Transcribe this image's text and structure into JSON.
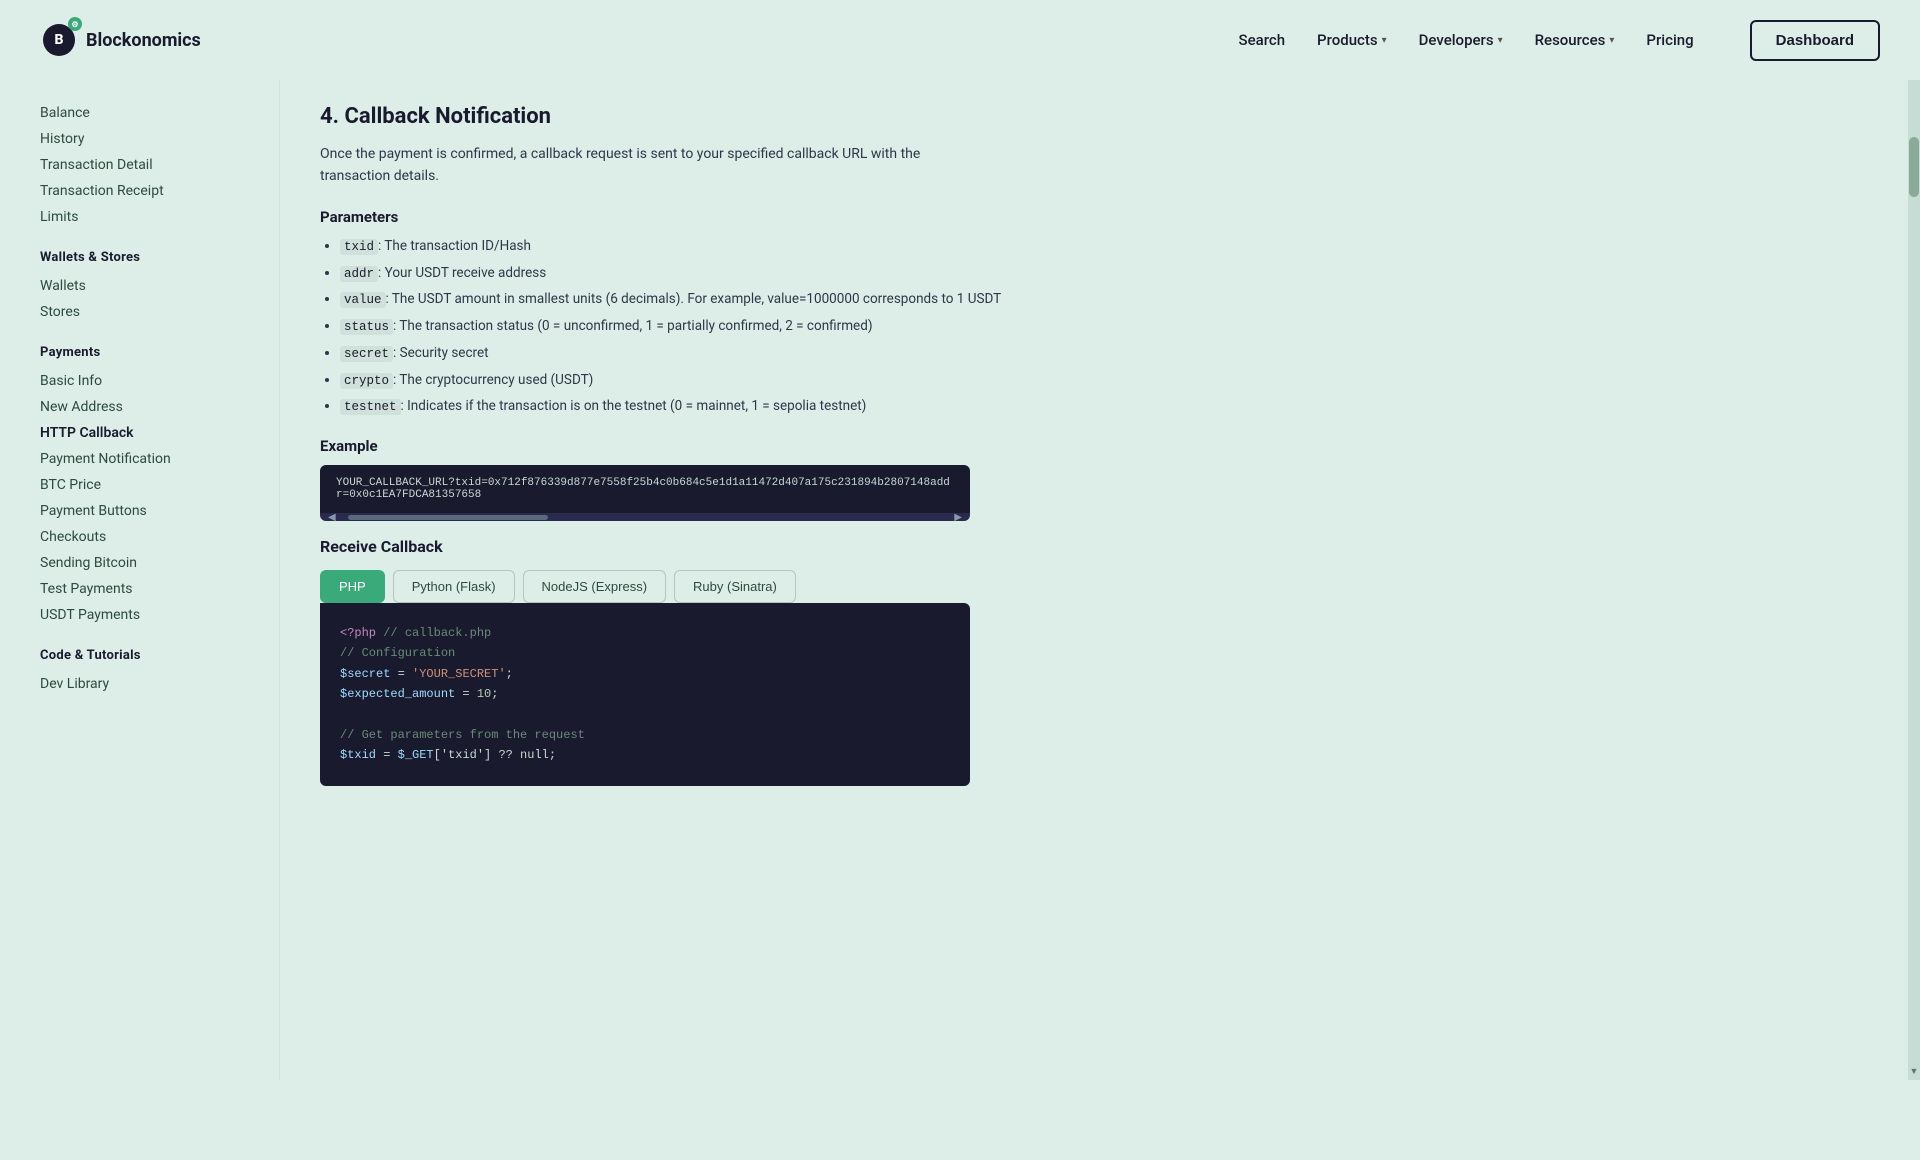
{
  "brand": {
    "name": "Blockonomics",
    "logo_letter": "B"
  },
  "nav": {
    "search": "Search",
    "products": "Products",
    "developers": "Developers",
    "resources": "Resources",
    "pricing": "Pricing",
    "dashboard": "Dashboard"
  },
  "sidebar": {
    "section_payments_above": {
      "items": [
        {
          "label": "Balance",
          "id": "balance"
        },
        {
          "label": "History",
          "id": "history"
        },
        {
          "label": "Transaction Detail",
          "id": "transaction-detail"
        },
        {
          "label": "Transaction Receipt",
          "id": "transaction-receipt"
        },
        {
          "label": "Limits",
          "id": "limits"
        }
      ]
    },
    "wallets_stores": {
      "title": "Wallets & Stores",
      "items": [
        {
          "label": "Wallets",
          "id": "wallets"
        },
        {
          "label": "Stores",
          "id": "stores"
        }
      ]
    },
    "payments": {
      "title": "Payments",
      "items": [
        {
          "label": "Basic Info",
          "id": "basic-info"
        },
        {
          "label": "New Address",
          "id": "new-address"
        },
        {
          "label": "HTTP Callback",
          "id": "http-callback"
        },
        {
          "label": "Payment Notification",
          "id": "payment-notification"
        },
        {
          "label": "BTC Price",
          "id": "btc-price"
        },
        {
          "label": "Payment Buttons",
          "id": "payment-buttons"
        },
        {
          "label": "Checkouts",
          "id": "checkouts"
        },
        {
          "label": "Sending Bitcoin",
          "id": "sending-bitcoin"
        },
        {
          "label": "Test Payments",
          "id": "test-payments"
        },
        {
          "label": "USDT Payments",
          "id": "usdt-payments"
        }
      ]
    },
    "code_tutorials": {
      "title": "Code & Tutorials",
      "items": [
        {
          "label": "Dev Library",
          "id": "dev-library"
        }
      ]
    }
  },
  "main": {
    "section_number": "4.",
    "section_title": "Callback Notification",
    "intro": "Once the payment is confirmed, a callback request is sent to your specified callback URL with the transaction details.",
    "parameters_heading": "Parameters",
    "params": [
      {
        "code": "txid",
        "desc": "The transaction ID/Hash"
      },
      {
        "code": "addr",
        "desc": "Your USDT receive address"
      },
      {
        "code": "value",
        "desc": "The USDT amount in smallest units (6 decimals). For example, value=1000000 corresponds to 1 USDT"
      },
      {
        "code": "status",
        "desc": "The transaction status (0 = unconfirmed, 1 = partially confirmed, 2 = confirmed)"
      },
      {
        "code": "secret",
        "desc": "Security secret"
      },
      {
        "code": "crypto",
        "desc": "The cryptocurrency used (USDT)"
      },
      {
        "code": "testnet",
        "desc": "Indicates if the transaction is on the testnet (0 = mainnet, 1 = sepolia testnet)"
      }
    ],
    "example_heading": "Example",
    "example_url": "YOUR_CALLBACK_URL?txid=0x712f876339d877e7558f25b4c0b684c5e1d1a11472d407a175c231894b2807148addr=0x0c1EA7FDCA81357658",
    "receive_callback_heading": "Receive Callback",
    "lang_tabs": [
      {
        "label": "PHP",
        "id": "php",
        "active": true
      },
      {
        "label": "Python (Flask)",
        "id": "python",
        "active": false
      },
      {
        "label": "NodeJS (Express)",
        "id": "nodejs",
        "active": false
      },
      {
        "label": "Ruby (Sinatra)",
        "id": "ruby",
        "active": false
      }
    ],
    "code_lines": [
      {
        "type": "keyword",
        "text": "<?php "
      },
      {
        "type": "comment",
        "text": "// callback.php"
      },
      {
        "type": "comment",
        "text": "// Configuration"
      },
      {
        "type": "variable_string",
        "var": "$secret",
        "op": " = ",
        "val": "'YOUR_SECRET'",
        "semi": ";"
      },
      {
        "type": "variable_number",
        "var": "$expected_amount",
        "op": " = ",
        "val": "10",
        "semi": ";"
      },
      {
        "type": "blank"
      },
      {
        "type": "comment",
        "text": "// Get parameters from the request"
      },
      {
        "type": "variable_expr",
        "var": "$txid",
        "op": " = ",
        "val": "$_GET['txid'] ?? null",
        "semi": ";"
      }
    ]
  }
}
